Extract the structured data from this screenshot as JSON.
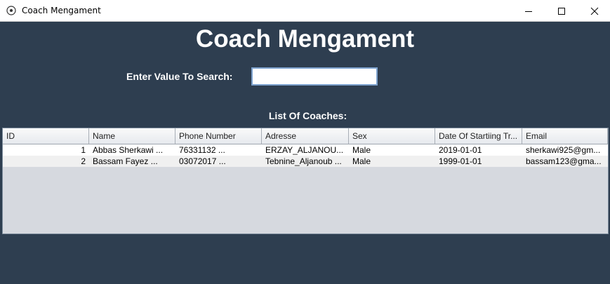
{
  "window": {
    "title": "Coach Mengament",
    "icon": "soccer-ball-icon",
    "controls": [
      "minimize-icon",
      "maximize-icon",
      "close-icon"
    ]
  },
  "heading": "Coach Mengament",
  "search": {
    "label": "Enter Value To Search:",
    "value": "",
    "placeholder": ""
  },
  "list_label": "List Of Coaches:",
  "table": {
    "columns": [
      "ID",
      "Name",
      "Phone Number",
      "Adresse",
      "Sex",
      "Date Of Startiing Tr...",
      "Email"
    ],
    "rows": [
      [
        "1",
        "Abbas Sherkawi      ...",
        "76331132           ...",
        "ERZAY_ALJANOU...",
        "Male",
        "2019-01-01",
        "sherkawi925@gm..."
      ],
      [
        "2",
        "Bassam Fayez       ...",
        "03072017           ...",
        "Tebnine_Aljanoub ...",
        "Male",
        "1999-01-01",
        "bassam123@gma..."
      ]
    ]
  }
}
